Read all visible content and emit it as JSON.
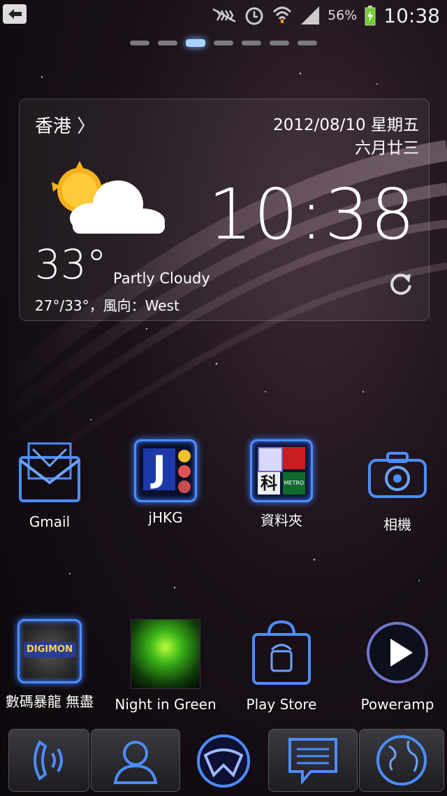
{
  "status_bar": {
    "battery_percent": "56%",
    "time": "10:38",
    "icons": [
      "back-key-icon",
      "nfc-mute-icon",
      "alarm-icon",
      "wifi-icon",
      "signal-icon",
      "battery-charging-icon"
    ]
  },
  "home_pages": {
    "count": 7,
    "active_index": 2
  },
  "weather_widget": {
    "city": "香港",
    "city_chevron": "〉",
    "date": "2012/08/10 星期五",
    "lunar_date": "六月廿三",
    "clock": "10:38",
    "temperature": "33°",
    "condition": "Partly Cloudy",
    "range_wind": "27°/33°，風向：West",
    "weather_icon": "partly-cloudy-icon"
  },
  "apps_row1": [
    {
      "label": "Gmail",
      "icon": "gmail-icon"
    },
    {
      "label": "jHKG",
      "icon": "jhkg-icon"
    },
    {
      "label": "資料夾",
      "icon": "folder-icon"
    },
    {
      "label": "相機",
      "icon": "camera-icon"
    }
  ],
  "folder_tiles": {
    "tile_3": "科",
    "tile_4": "METRO"
  },
  "jhkg_letter": "J",
  "apps_row2": [
    {
      "label": "數碼暴龍 無盡",
      "icon": "digimon-icon"
    },
    {
      "label": "Night in Green",
      "icon": "night-in-green-icon"
    },
    {
      "label": "Play Store",
      "icon": "play-store-icon"
    },
    {
      "label": "Poweramp",
      "icon": "poweramp-icon"
    }
  ],
  "dock": [
    "phone-icon",
    "contacts-icon",
    "app-drawer-icon",
    "messaging-icon",
    "browser-icon"
  ],
  "colors": {
    "neon_blue": "#4c8dff",
    "widget_border": "#ffffff"
  }
}
